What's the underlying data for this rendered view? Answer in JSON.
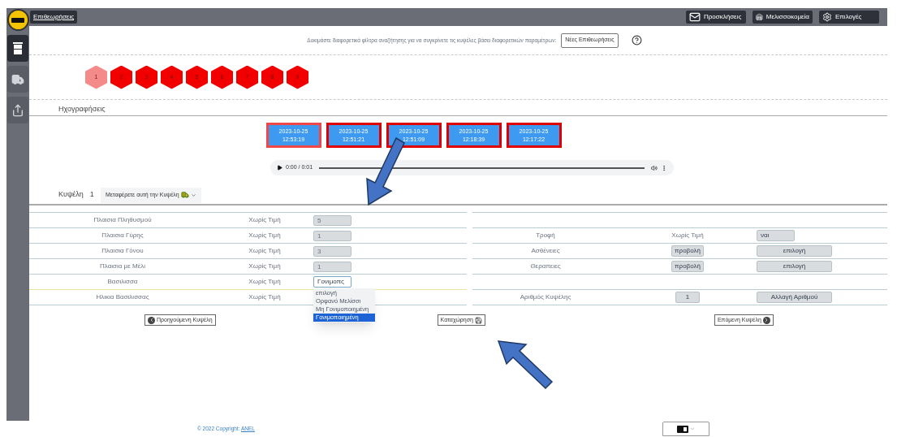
{
  "sidebar": {
    "items": [
      {
        "kind": "list",
        "selected": true
      },
      {
        "kind": "truck",
        "selected": false
      },
      {
        "kind": "share",
        "selected": false
      }
    ]
  },
  "topbar": {
    "title": "Επιθεωρήσεις",
    "actions": [
      {
        "kind": "invite",
        "label": "Προσκλήσεις"
      },
      {
        "kind": "apiary",
        "label": "Μελισσοκομεία"
      },
      {
        "kind": "settings",
        "label": "Επιλογές"
      }
    ]
  },
  "filter_bar": {
    "hint": "Δοκιμάστε διαφορετικά φίλτρα αναζήτησης για να συγκρίνετε τις κυψέλες βάσει διαφορετικών παραμέτρων:",
    "button": "Νέες Επιθεωρήσεις"
  },
  "hives": [
    {
      "label": "1",
      "selected": true
    },
    {
      "label": "2",
      "selected": false
    },
    {
      "label": "3",
      "selected": false
    },
    {
      "label": "4",
      "selected": false
    },
    {
      "label": "5",
      "selected": false
    },
    {
      "label": "6",
      "selected": false
    },
    {
      "label": "7",
      "selected": false
    },
    {
      "label": "8",
      "selected": false
    },
    {
      "label": "9",
      "selected": false
    }
  ],
  "recordings": {
    "title": "Ηχογραφήσεις",
    "items": [
      {
        "date": "2023-10-25",
        "time": "12:53:19",
        "selected": true
      },
      {
        "date": "2023-10-25",
        "time": "12:51:21",
        "selected": false
      },
      {
        "date": "2023-10-25",
        "time": "12:51:09",
        "selected": false
      },
      {
        "date": "2023-10-25",
        "time": "12:18:39",
        "selected": false
      },
      {
        "date": "2023-10-25",
        "time": "12:17:22",
        "selected": false
      }
    ],
    "player": {
      "time": "0:00 / 0:01"
    }
  },
  "hive": {
    "label": "Κυψέλη",
    "number": "1",
    "move_menu": "Μεταφέρετε αυτή την Κυψέλη"
  },
  "left_rows": [
    {
      "kind": "input",
      "label": "Πλαισια Πληθυσμού",
      "value": "Χωρίς Τιμή",
      "field": "5"
    },
    {
      "kind": "input",
      "label": "Πλαισια Γύρης",
      "value": "Χωρίς Τιμή",
      "field": "1"
    },
    {
      "kind": "input",
      "label": "Πλαισια Γόνου",
      "value": "Χωρίς Τιμή",
      "field": "3"
    },
    {
      "kind": "input",
      "label": "Πλαισια με Μέλι",
      "value": "Χωρίς Τιμή",
      "field": "1"
    },
    {
      "kind": "select",
      "label": "Βασιλισσα",
      "value": "Χωρίς Τιμή",
      "field": "Γονιμοπς",
      "options": [
        {
          "label": "επιλογή",
          "selected": false
        },
        {
          "label": "Ορφανό Μελίσσι",
          "selected": false
        },
        {
          "label": "Μη Γονιμοποιημένη",
          "selected": false
        },
        {
          "label": "Γονιμοποιημένη",
          "selected": true
        }
      ]
    },
    {
      "kind": "text",
      "label": "Ηλικια Βασιλισσας",
      "value": "Χωρίς Τιμή"
    }
  ],
  "right_rows": [
    {
      "kind": "empty"
    },
    {
      "kind": "input",
      "label": "Τροφή",
      "value": "Χωρίς Τιμή",
      "field": "ναι"
    },
    {
      "kind": "buttons",
      "label": "Ασθένειες",
      "view": "προβολή",
      "action": "επιλογή"
    },
    {
      "kind": "buttons",
      "label": "Θεραπειες",
      "view": "προβολή",
      "action": "επιλογή"
    },
    {
      "kind": "empty"
    },
    {
      "kind": "number",
      "label": "Αριθμός Κυψέλης",
      "field": "1",
      "action": "Αλλαγή Αριθμού"
    }
  ],
  "nav": {
    "previous": "Προηγούμενη Κυψέλη",
    "save": "Καταχώρηση",
    "next": "Επόμενη Κυψέλη"
  },
  "footer": {
    "copyright": "© 2022 Copyright:",
    "link": "ANEL"
  }
}
